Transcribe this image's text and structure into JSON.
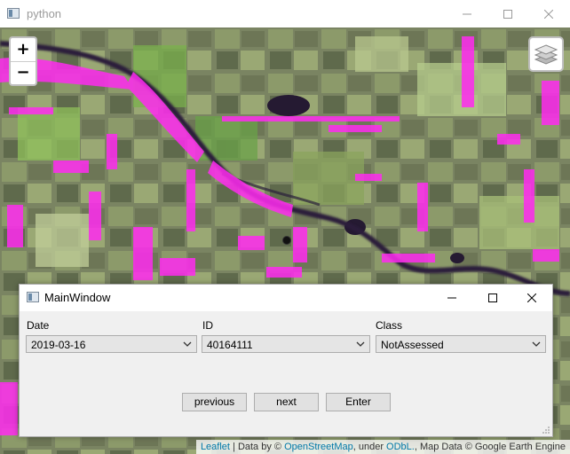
{
  "outer_window": {
    "title": "python",
    "controls": {
      "minimize": "—",
      "maximize": "☐",
      "close": "✕"
    }
  },
  "map": {
    "zoom_in": "+",
    "zoom_out": "−",
    "layers_icon": "layers-icon",
    "attribution": {
      "leaflet": "Leaflet",
      "sep1": " | Data by © ",
      "osm": "OpenStreetMap",
      "sep2": ", under ",
      "odbl": "ODbL.",
      "sep3": ", Map Data © Google Earth Engine"
    }
  },
  "dialog": {
    "title": "MainWindow",
    "controls": {
      "minimize": "—",
      "maximize": "☐",
      "close": "✕"
    },
    "fields": {
      "date": {
        "label": "Date",
        "value": "2019-03-16"
      },
      "id": {
        "label": "ID",
        "value": "40164111"
      },
      "class": {
        "label": "Class",
        "value": "NotAssessed"
      }
    },
    "buttons": {
      "previous": "previous",
      "next": "next",
      "enter": "Enter"
    }
  },
  "colors": {
    "map_base": "#6f7a5c",
    "magenta_overlay": "#ff2bf0",
    "river": "#2a1f3a",
    "link": "#0078a8"
  }
}
